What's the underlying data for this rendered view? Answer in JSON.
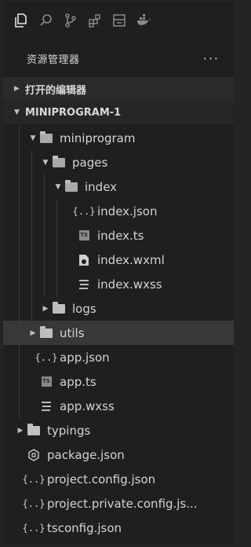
{
  "explorer": {
    "title": "资源管理器",
    "more": "···"
  },
  "sections": {
    "open_editors": "打开的编辑器",
    "project": "MINIPROGRAM-1"
  },
  "tree": [
    {
      "label": "miniprogram",
      "depth": 1,
      "kind": "folder-open",
      "twisty": "open"
    },
    {
      "label": "pages",
      "depth": 2,
      "kind": "folder-open",
      "twisty": "open"
    },
    {
      "label": "index",
      "depth": 3,
      "kind": "folder-open",
      "twisty": "open"
    },
    {
      "label": "index.json",
      "depth": 4,
      "kind": "json"
    },
    {
      "label": "index.ts",
      "depth": 4,
      "kind": "ts"
    },
    {
      "label": "index.wxml",
      "depth": 4,
      "kind": "wxml"
    },
    {
      "label": "index.wxss",
      "depth": 4,
      "kind": "wxss"
    },
    {
      "label": "logs",
      "depth": 2,
      "kind": "folder",
      "twisty": "closed"
    },
    {
      "label": "utils",
      "depth": 1,
      "kind": "folder",
      "twisty": "closed",
      "selected": true
    },
    {
      "label": "app.json",
      "depth": 1,
      "kind": "json"
    },
    {
      "label": "app.ts",
      "depth": 1,
      "kind": "ts"
    },
    {
      "label": "app.wxss",
      "depth": 1,
      "kind": "wxss"
    },
    {
      "label": "typings",
      "depth": 0,
      "kind": "folder-ts",
      "twisty": "closed"
    },
    {
      "label": "package.json",
      "depth": 0,
      "kind": "npm"
    },
    {
      "label": "project.config.json",
      "depth": 0,
      "kind": "json"
    },
    {
      "label": "project.private.config.js...",
      "depth": 0,
      "kind": "json"
    },
    {
      "label": "tsconfig.json",
      "depth": 0,
      "kind": "json"
    }
  ]
}
